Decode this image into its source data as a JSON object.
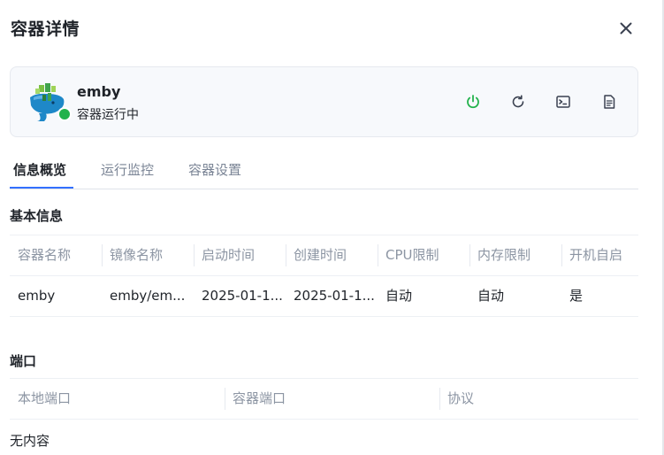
{
  "dialog": {
    "title": "容器详情"
  },
  "container": {
    "name": "emby",
    "status": "容器运行中",
    "actions": [
      "power-icon",
      "restart-icon",
      "terminal-icon",
      "log-icon"
    ],
    "status_color": "#22b24c"
  },
  "tabs": [
    {
      "label": "信息概览",
      "active": true
    },
    {
      "label": "运行监控",
      "active": false
    },
    {
      "label": "容器设置",
      "active": false
    }
  ],
  "basic_info": {
    "title": "基本信息",
    "columns": [
      "容器名称",
      "镜像名称",
      "启动时间",
      "创建时间",
      "CPU限制",
      "内存限制",
      "开机自启"
    ],
    "row": [
      "emby",
      "emby/em...",
      "2025-01-1...",
      "2025-01-1...",
      "自动",
      "自动",
      "是"
    ]
  },
  "ports": {
    "title": "端口",
    "columns": [
      "本地端口",
      "容器端口",
      "协议"
    ],
    "empty_text": "无内容"
  },
  "colors": {
    "accent": "#3370ff",
    "running": "#22b24c"
  }
}
